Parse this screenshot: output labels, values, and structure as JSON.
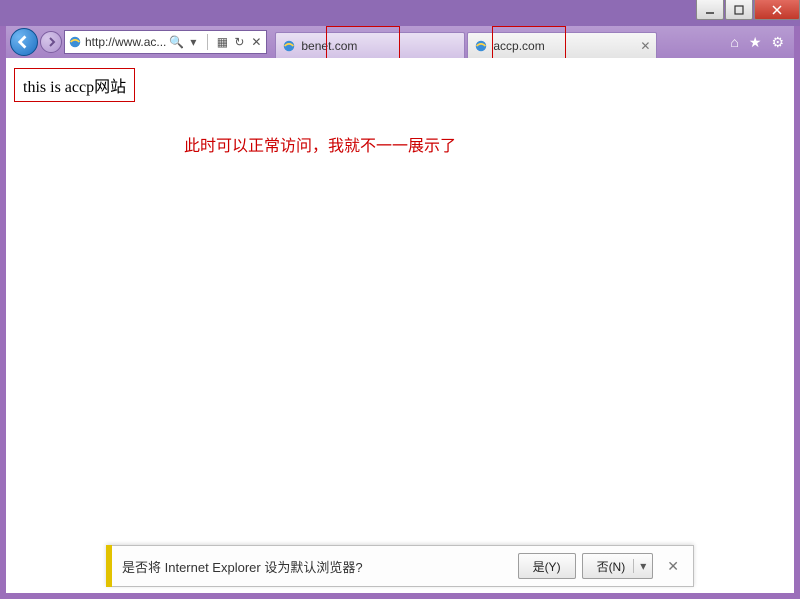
{
  "window": {
    "minimize_tip": "Minimize",
    "maximize_tip": "Maximize",
    "close_tip": "Close"
  },
  "nav": {
    "back_tip": "Back",
    "forward_tip": "Forward",
    "url_display": "http://www.ac...",
    "search_hint": "Search",
    "refresh_tip": "Refresh",
    "stop_tip": "Stop"
  },
  "tabs": [
    {
      "title": "benet.com",
      "active": false
    },
    {
      "title": "accp.com",
      "active": true
    }
  ],
  "tools": {
    "home_tip": "Home",
    "fav_tip": "Favorites",
    "settings_tip": "Tools"
  },
  "page": {
    "boxed_text": "this is accp网站",
    "annotation": "此时可以正常访问，我就不一一展示了"
  },
  "notify": {
    "message": "是否将 Internet Explorer 设为默认浏览器?",
    "yes_label": "是(Y)",
    "no_label": "否(N)",
    "close_tip": "Close"
  }
}
